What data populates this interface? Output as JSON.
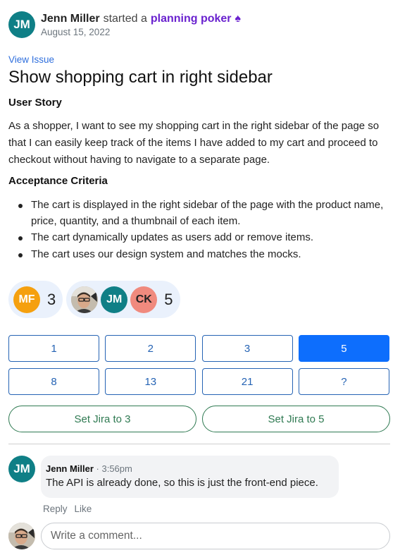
{
  "post": {
    "author_initials": "JM",
    "author_name": "Jenn Miller",
    "action": "started a",
    "activity_link": "planning poker",
    "activity_icon": "spade-icon",
    "date": "August 15, 2022"
  },
  "issue": {
    "view_link": "View Issue",
    "title": "Show shopping cart in right sidebar",
    "story_heading": "User Story",
    "story": "As a shopper, I want to see my shopping cart in the right sidebar of the page so that I can easily keep track of the items I have added to my cart and proceed to checkout without having to navigate to a separate page.",
    "criteria_heading": "Acceptance Criteria",
    "criteria": [
      "The cart is displayed in the right sidebar of the page with the product name, price, quantity, and a thumbnail of each item.",
      "The cart dynamically updates as users add or remove items.",
      "The cart uses our design system and matches the mocks."
    ]
  },
  "votes": [
    {
      "voters": [
        "MF"
      ],
      "value": "3"
    },
    {
      "voters": [
        "photo",
        "JM",
        "CK"
      ],
      "value": "5"
    }
  ],
  "avatar_colors": {
    "MF": "#f5a00f",
    "JM": "#0f7f86",
    "CK": "#f08a7e"
  },
  "cards": [
    "1",
    "2",
    "3",
    "5",
    "8",
    "13",
    "21",
    "?"
  ],
  "selected_card": "5",
  "jira_buttons": [
    "Set Jira to 3",
    "Set Jira to 5"
  ],
  "comment": {
    "initials": "JM",
    "author": "Jenn Miller",
    "time": " · 3:56pm",
    "text": "The API is already done, so this is just the front-end piece.",
    "reply": "Reply",
    "like": "Like"
  },
  "composer": {
    "placeholder": "Write a comment..."
  }
}
